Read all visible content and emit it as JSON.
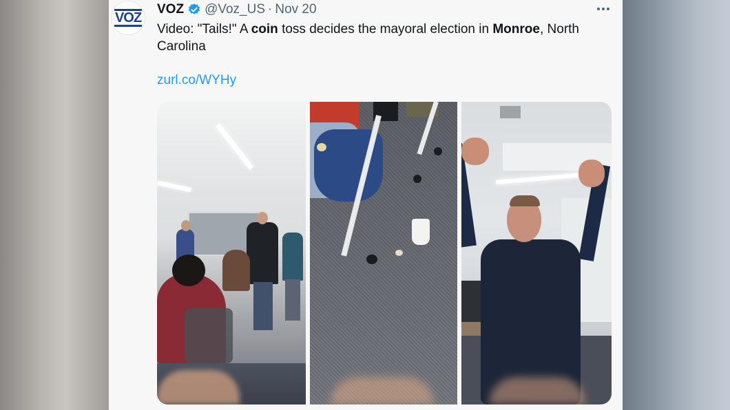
{
  "tweet": {
    "avatar_text": "VOZ",
    "name": "VOZ",
    "handle": "@Voz_US",
    "separator": "·",
    "date": "Nov 20",
    "text_prefix": "Video: \"Tails!\" A ",
    "text_bold1": "coin",
    "text_mid": " toss decides the mayoral election in ",
    "text_bold2": "Monroe",
    "text_suffix": ", North Carolina",
    "link": "zurl.co/WYHy"
  },
  "colors": {
    "verified": "#1d9bf0",
    "link": "#1d9bf0",
    "brand": "#1c3f8f"
  },
  "icons": {
    "verified": "verified-badge-icon",
    "more": "more-options-icon"
  }
}
